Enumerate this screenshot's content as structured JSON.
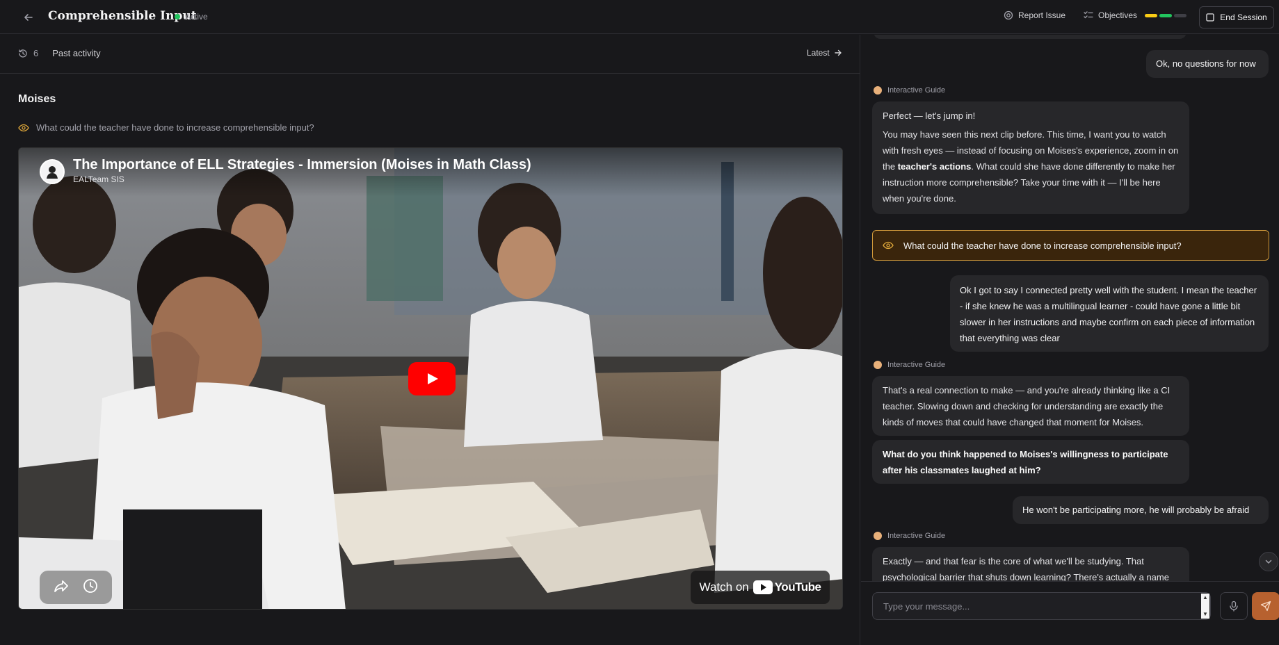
{
  "header": {
    "title": "Comprehensible Input",
    "status": "Active",
    "report_label": "Report Issue",
    "objectives_label": "Objectives",
    "objectives_progress": [
      "#facc15",
      "#22c55e",
      "#3f3f46"
    ],
    "end_label": "End Session"
  },
  "activity": {
    "count": "6",
    "label": "Past activity",
    "latest_label": "Latest"
  },
  "main": {
    "section_title": "Moises",
    "prompt": "What could the teacher have done to increase comprehensible input?"
  },
  "video": {
    "title": "The Importance of ELL Strategies - Immersion (Moises in Math Class)",
    "channel": "EALTeam SIS",
    "watch_on": "Watch on",
    "youtube": "YouTube"
  },
  "chat": {
    "guide_name": "Interactive Guide",
    "msg1": "Ok, no questions for now",
    "guide1_p1": "Perfect — let's jump in!",
    "guide1_p2a": "You may have seen this next clip before. This time, I want you to watch with fresh eyes — instead of focusing on Moises's experience, zoom in on the ",
    "guide1_p2b": "teacher's actions",
    "guide1_p2c": ". What could she have done differently to make her instruction more comprehensible? Take your time with it — I'll be here when you're done.",
    "highlight": "What could the teacher have done to increase comprehensible input?",
    "msg2": "Ok I got to say I connected pretty well with the student. I mean the teacher - if she knew he was a multilingual learner - could have gone a little bit slower in her instructions and maybe confirm on each piece of information that everything was clear",
    "guide2": "That's a real connection to make — and you're already thinking like a CI teacher. Slowing down and checking for understanding are exactly the kinds of moves that could have changed that moment for Moises.",
    "guide3": "What do you think happened to Moises's willingness to participate after his classmates laughed at him?",
    "msg3": "He won't be participating more, he will probably be afraid",
    "guide4": "Exactly — and that fear is the core of what we'll be studying. That psychological barrier that shuts down learning? There's actually a name"
  },
  "composer": {
    "placeholder": "Type your message..."
  }
}
